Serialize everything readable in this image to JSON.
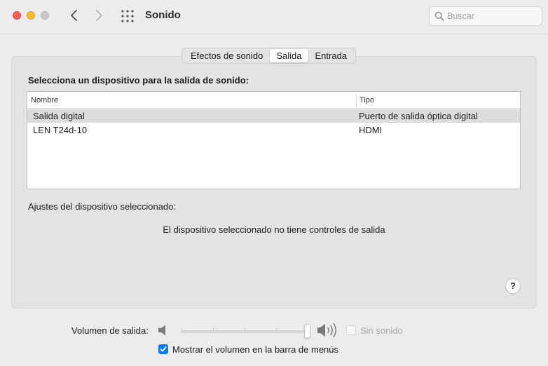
{
  "window": {
    "title": "Sonido",
    "controls": {
      "close_color": "#fe5f57",
      "minimize_color": "#febc2e",
      "maximize_color": "#c9c9c9"
    }
  },
  "toolbar": {
    "back_icon": "chevron-left-icon",
    "forward_icon": "chevron-right-icon",
    "grid_icon": "grid-icon",
    "search": {
      "placeholder": "Buscar",
      "value": "",
      "icon": "search-icon"
    }
  },
  "tabs": [
    {
      "label": "Efectos de sonido",
      "active": false
    },
    {
      "label": "Salida",
      "active": true
    },
    {
      "label": "Entrada",
      "active": false
    }
  ],
  "output": {
    "heading": "Selecciona un dispositivo para la salida de sonido:",
    "table": {
      "columns": [
        "Nombre",
        "Tipo"
      ],
      "rows": [
        {
          "name": "Salida digital",
          "type": "Puerto de salida óptica digital",
          "selected": true
        },
        {
          "name": "LEN T24d-10",
          "type": "HDMI",
          "selected": false
        }
      ]
    },
    "settings_label": "Ajustes del dispositivo seleccionado:",
    "no_controls_message": "El dispositivo seleccionado no tiene controles de salida"
  },
  "help_label": "?",
  "volume": {
    "label": "Volumen de salida:",
    "level": 1.0,
    "mute_label": "Sin sonido",
    "mute_checked": false,
    "mute_enabled": false,
    "show_in_menu_bar_label": "Mostrar el volumen en la barra de menús",
    "show_in_menu_bar_checked": true
  },
  "colors": {
    "accent": "#0a7aff",
    "selected_row": "#dcdcdc"
  }
}
